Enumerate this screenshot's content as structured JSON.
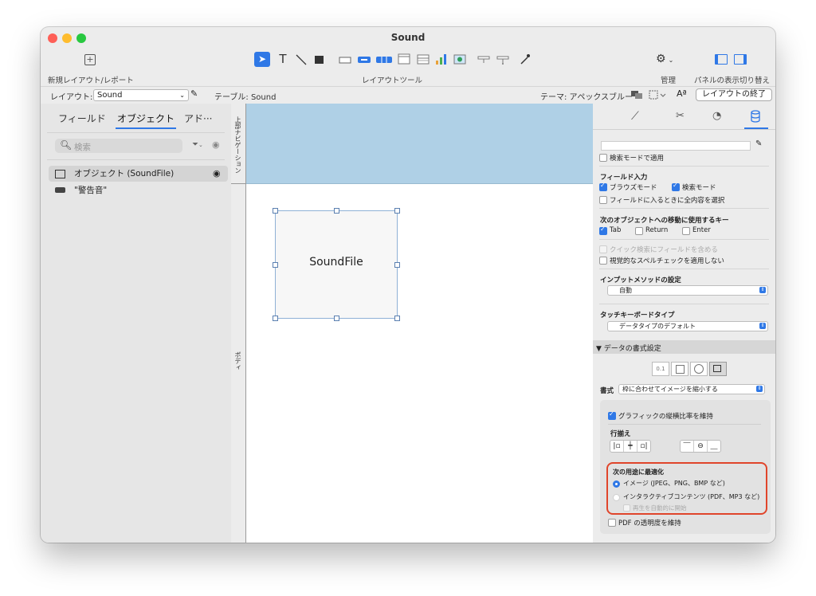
{
  "window": {
    "title": "Sound"
  },
  "toolbar": {
    "new_layout_label": "新規レイアウト/レポート",
    "layout_tools_label": "レイアウトツール",
    "manage_label": "管理",
    "panel_toggle_label": "パネルの表示切り替え"
  },
  "subbar": {
    "layout_prefix": "レイアウト:",
    "layout_value": "Sound",
    "table_text": "テーブル: Sound",
    "theme_text": "テーマ: アペックスブルー",
    "exit_layout_button": "レイアウトの終了"
  },
  "left_panel": {
    "tabs": [
      "フィールド",
      "オブジェクト",
      "アド···"
    ],
    "search_placeholder": "検索",
    "objects": [
      {
        "label": "オブジェクト (SoundFile)"
      },
      {
        "label": "\"警告音\""
      }
    ]
  },
  "ruler": {
    "top_nav_label": "上部ナビゲーション",
    "body_label": "ボディ"
  },
  "canvas": {
    "field_label": "SoundFile"
  },
  "inspector": {
    "apply_find_mode": "検索モードで適用",
    "field_entry_heading": "フィールド入力",
    "browse_mode": "ブラウズモード",
    "find_mode": "検索モード",
    "select_all_on_entry": "フィールドに入るときに全内容を選択",
    "next_object_heading": "次のオブジェクトへの移動に使用するキー",
    "key_tab": "Tab",
    "key_return": "Return",
    "key_enter": "Enter",
    "include_in_quick_find": "クイック検索にフィールドを含める",
    "no_visual_spellcheck": "視覚的なスペルチェックを適用しない",
    "input_method_heading": "インプットメソッドの設定",
    "input_method_value": "自動",
    "touch_keyboard_heading": "タッチキーボードタイプ",
    "touch_keyboard_value": "データタイプのデフォルト",
    "data_format_heading": "▼ データの書式設定",
    "format_decimal_glyph": "0.1",
    "format_label": "書式",
    "format_value": "枠に合わせてイメージを縮小する",
    "maintain_aspect": "グラフィックの縦横比率を維持",
    "alignment_heading": "行揃え",
    "optimize_heading": "次の用途に最適化",
    "optimize_images": "イメージ (JPEG、PNG、BMP など)",
    "optimize_interactive": "インタラクティブコンテンツ (PDF、MP3 など)",
    "auto_play": "再生を自動的に開始",
    "pdf_transparency": "PDF の透明度を維持"
  },
  "colors": {
    "accent": "#2f78e6",
    "header_band": "#afd0e6",
    "highlight_ring": "#e0452b"
  }
}
